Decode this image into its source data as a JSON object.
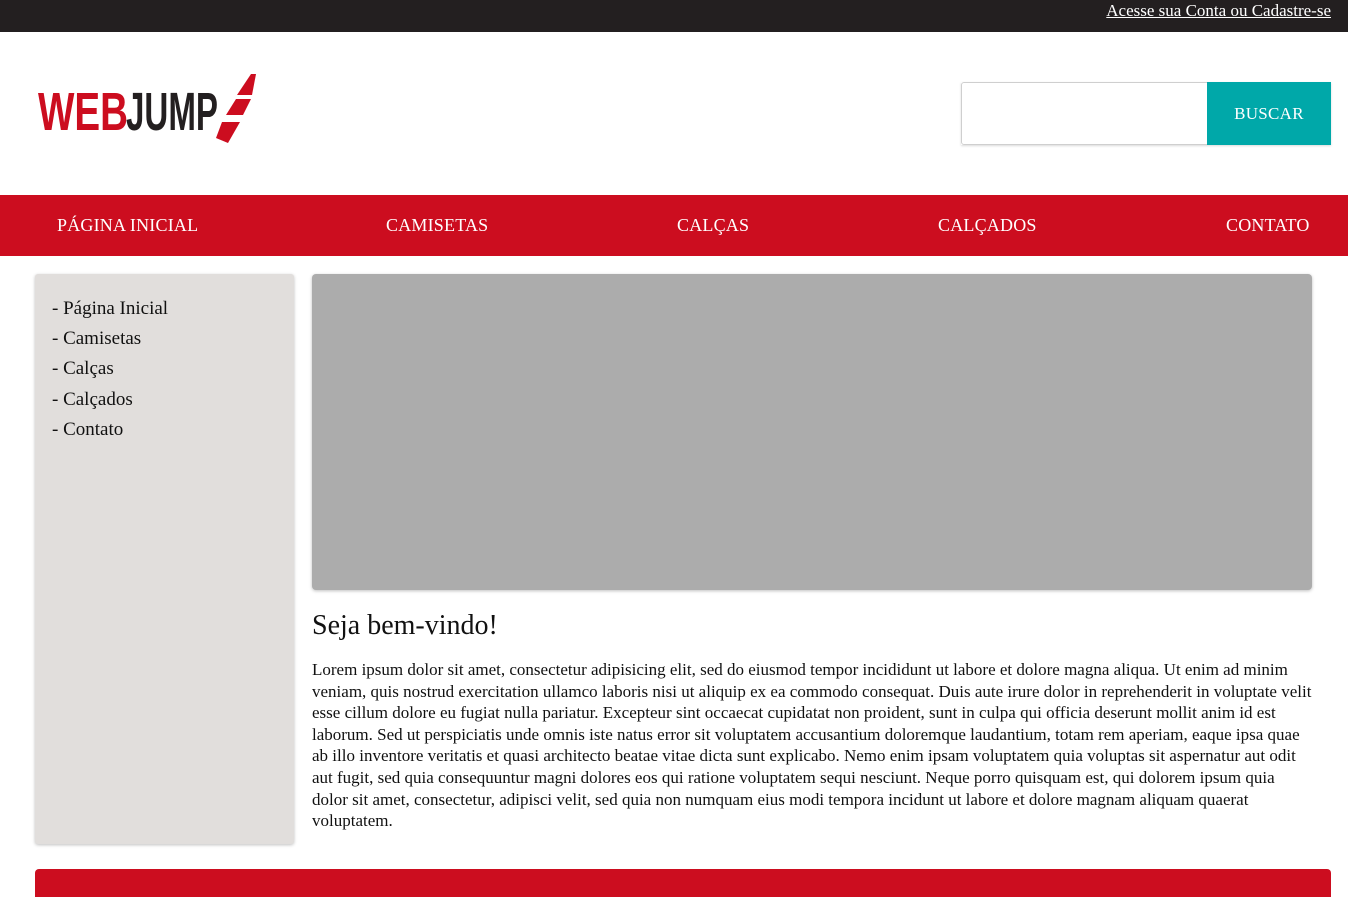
{
  "topbar": {
    "account_link": "Acesse sua Conta ou Cadastre-se"
  },
  "logo": {
    "text_web": "WEB",
    "text_jump": "JUMP",
    "brand_red": "#cc0d1f",
    "brand_dark": "#231f20"
  },
  "search": {
    "value": "",
    "placeholder": "",
    "button_label": "BUSCAR",
    "button_color": "#00a8a9"
  },
  "nav": {
    "color": "#cc0d1f",
    "items": [
      {
        "label": "PÁGINA INICIAL"
      },
      {
        "label": "CAMISETAS"
      },
      {
        "label": "CALÇAS"
      },
      {
        "label": "CALÇADOS"
      },
      {
        "label": "CONTATO"
      }
    ]
  },
  "sidebar": {
    "items": [
      {
        "label": "- Página Inicial"
      },
      {
        "label": "- Camisetas"
      },
      {
        "label": "- Calças"
      },
      {
        "label": "- Calçados"
      },
      {
        "label": "- Contato"
      }
    ]
  },
  "main": {
    "title": "Seja bem-vindo!",
    "body": "Lorem ipsum dolor sit amet, consectetur adipisicing elit, sed do eiusmod tempor incididunt ut labore et dolore magna aliqua. Ut enim ad minim veniam, quis nostrud exercitation ullamco laboris nisi ut aliquip ex ea commodo consequat. Duis aute irure dolor in reprehenderit in voluptate velit esse cillum dolore eu fugiat nulla pariatur. Excepteur sint occaecat cupidatat non proident, sunt in culpa qui officia deserunt mollit anim id est laborum. Sed ut perspiciatis unde omnis iste natus error sit voluptatem accusantium doloremque laudantium, totam rem aperiam, eaque ipsa quae ab illo inventore veritatis et quasi architecto beatae vitae dicta sunt explicabo. Nemo enim ipsam voluptatem quia voluptas sit aspernatur aut odit aut fugit, sed quia consequuntur magni dolores eos qui ratione voluptatem sequi nesciunt. Neque porro quisquam est, qui dolorem ipsum quia dolor sit amet, consectetur, adipisci velit, sed quia non numquam eius modi tempora incidunt ut labore et dolore magnam aliquam quaerat voluptatem."
  }
}
